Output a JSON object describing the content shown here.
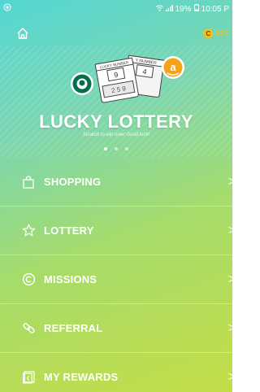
{
  "status_bar": {
    "left_icon": "settings-dot-icon",
    "battery_percent": "19%",
    "time": "10:05 P"
  },
  "app_bar": {
    "home_icon": "home-icon",
    "coin_symbol": "C",
    "coin_count": "327"
  },
  "banner": {
    "ticket1_header": "LUCKY NUMBER",
    "ticket1_top_number": "9",
    "ticket1_bottom_numbers": "2 5 9",
    "ticket2_header": "Y NUMBER",
    "ticket2_top_number": "4",
    "title": "LUCKY LOTTERY",
    "subtitle": "Scratch to win now! Good luck!",
    "amazon_letter": "a",
    "active_slide": 1,
    "slide_count": 3
  },
  "menu": {
    "items": [
      {
        "label": "SHOPPING",
        "icon": "shopping-bag-icon"
      },
      {
        "label": "LOTTERY",
        "icon": "star-icon"
      },
      {
        "label": "MISSIONS",
        "icon": "copyright-circle-icon"
      },
      {
        "label": "REFERRAL",
        "icon": "link-icon"
      },
      {
        "label": "MY REWARDS",
        "icon": "reward-card-icon"
      }
    ],
    "chevron": ">"
  },
  "colors": {
    "gradient_top": "#54d7d3",
    "gradient_bottom": "#c3dd47",
    "coin": "#f3c21a",
    "text": "#ffffff"
  }
}
